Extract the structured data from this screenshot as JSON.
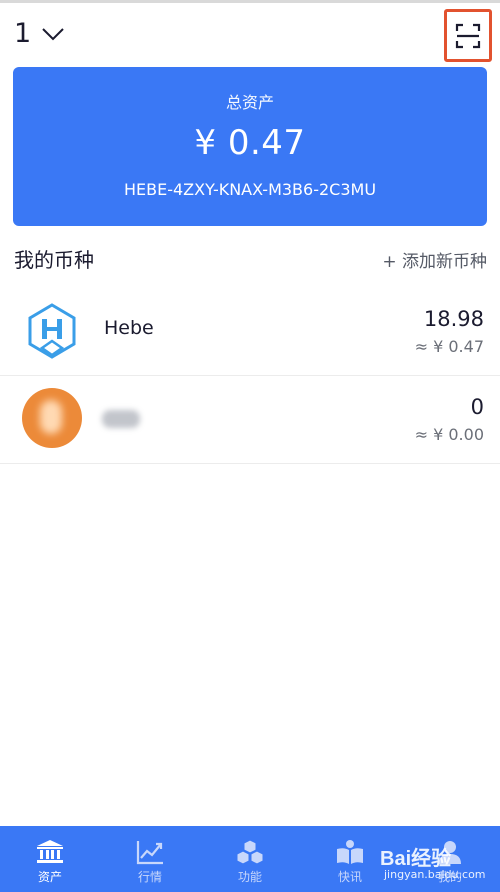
{
  "header": {
    "wallet_number": "1",
    "icons": {
      "selector": "chevron-down-icon",
      "scan": "scan-icon"
    },
    "scan_highlight_color": "#e2522f"
  },
  "asset_card": {
    "label": "总资产",
    "total": "¥ 0.47",
    "address": "HEBE-4ZXY-KNAX-M3B6-2C3MU",
    "background_color": "#3a78f5"
  },
  "coins_section": {
    "title": "我的币种",
    "add_label": "+ 添加新币种"
  },
  "coins": [
    {
      "name": "Hebe",
      "amount": "18.98",
      "value": "≈ ¥ 0.47",
      "icon": "hebe-logo-icon"
    },
    {
      "name": "",
      "amount": "0",
      "value": "≈ ¥ 0.00",
      "icon": "orange-coin-avatar",
      "name_obscured": true
    }
  ],
  "tabbar": {
    "tabs": [
      {
        "label": "资产",
        "icon": "bank-icon",
        "active": true
      },
      {
        "label": "行情",
        "icon": "chart-icon",
        "active": false
      },
      {
        "label": "功能",
        "icon": "cubes-icon",
        "active": false
      },
      {
        "label": "快讯",
        "icon": "book-icon",
        "active": false
      },
      {
        "label": "我的",
        "icon": "user-icon",
        "active": false
      }
    ]
  },
  "watermark": {
    "main": "Bai经验",
    "sub": "jingyan.baidu.com"
  }
}
